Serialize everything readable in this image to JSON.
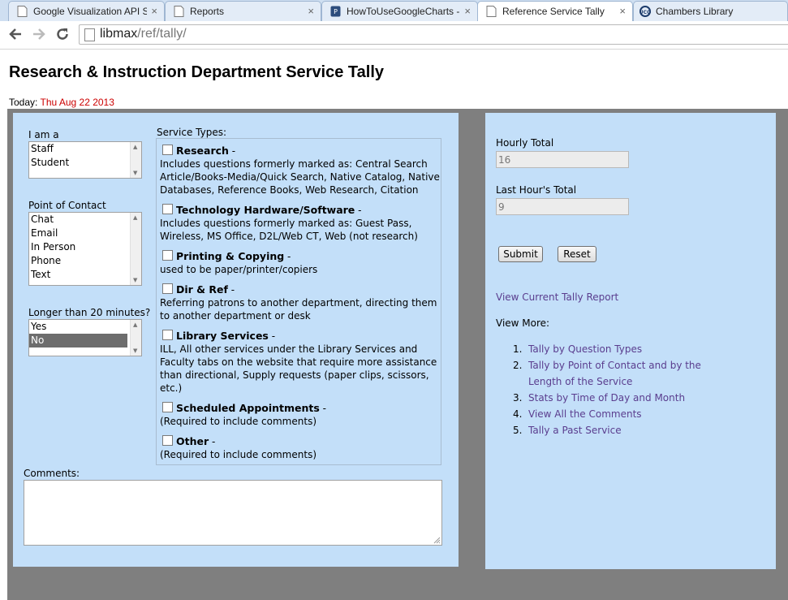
{
  "browser": {
    "tabs": [
      {
        "label": "Google Visualization API S",
        "icon": "page-icon"
      },
      {
        "label": "Reports",
        "icon": "page-icon"
      },
      {
        "label": "HowToUseGoogleCharts -",
        "icon": "wiki-icon"
      },
      {
        "label": "Reference Service Tally",
        "icon": "page-icon"
      },
      {
        "label": "Chambers Library",
        "icon": "uco-icon"
      }
    ],
    "close_glyph": "×",
    "url_host": "libmax",
    "url_path": "/ref/tally/"
  },
  "page": {
    "title": "Research & Instruction Department Service Tally",
    "today_label": "Today:",
    "today_date": "Thu Aug 22 2013"
  },
  "form": {
    "role": {
      "label": "I am a",
      "options": [
        "Staff",
        "Student"
      ]
    },
    "contact": {
      "label": "Point of Contact",
      "options": [
        "Chat",
        "Email",
        "In Person",
        "Phone",
        "Text"
      ]
    },
    "longer": {
      "label": "Longer than 20 minutes?",
      "options": [
        "Yes",
        "No"
      ],
      "selected": "No"
    },
    "service_types_label": "Service Types:",
    "services": [
      {
        "name": "Research",
        "desc": "Includes questions formerly marked as: Central Search Article/Books-Media/Quick Search, Native Catalog, Native Databases, Reference Books, Web Research, Citation"
      },
      {
        "name": "Technology Hardware/Software",
        "desc": "Includes questions formerly marked as: Guest Pass, Wireless, MS Office, D2L/Web CT, Web (not research)"
      },
      {
        "name": "Printing & Copying",
        "desc": "used to be paper/printer/copiers"
      },
      {
        "name": "Dir & Ref",
        "desc": "Referring patrons to another department, directing them to another department or desk"
      },
      {
        "name": "Library Services",
        "desc": "ILL, All other services under the Library Services and Faculty tabs on the website that require more assistance than directional, Supply requests (paper clips, scissors, etc.)"
      },
      {
        "name": "Scheduled Appointments",
        "desc": "(Required to include comments)"
      },
      {
        "name": "Other",
        "desc": "(Required to include comments)"
      }
    ],
    "name_suffix": " -",
    "comments_label": "Comments:"
  },
  "sidebar": {
    "hourly_total_label": "Hourly Total",
    "hourly_total_value": "16",
    "last_hour_label": "Last Hour's Total",
    "last_hour_value": "9",
    "submit_label": "Submit",
    "reset_label": "Reset",
    "current_report_link": "View Current Tally Report",
    "view_more_label": "View More:",
    "more_links": [
      "Tally by Question Types",
      "Tally by Point of Contact and by the Length of the Service",
      "Stats by Time of Day and Month",
      "View All the Comments",
      "Tally a Past Service"
    ]
  },
  "colors": {
    "panel": "#c3dff9",
    "backdrop": "#7f7f7f",
    "date": "#cc0000",
    "link": "#5a3d8e"
  }
}
